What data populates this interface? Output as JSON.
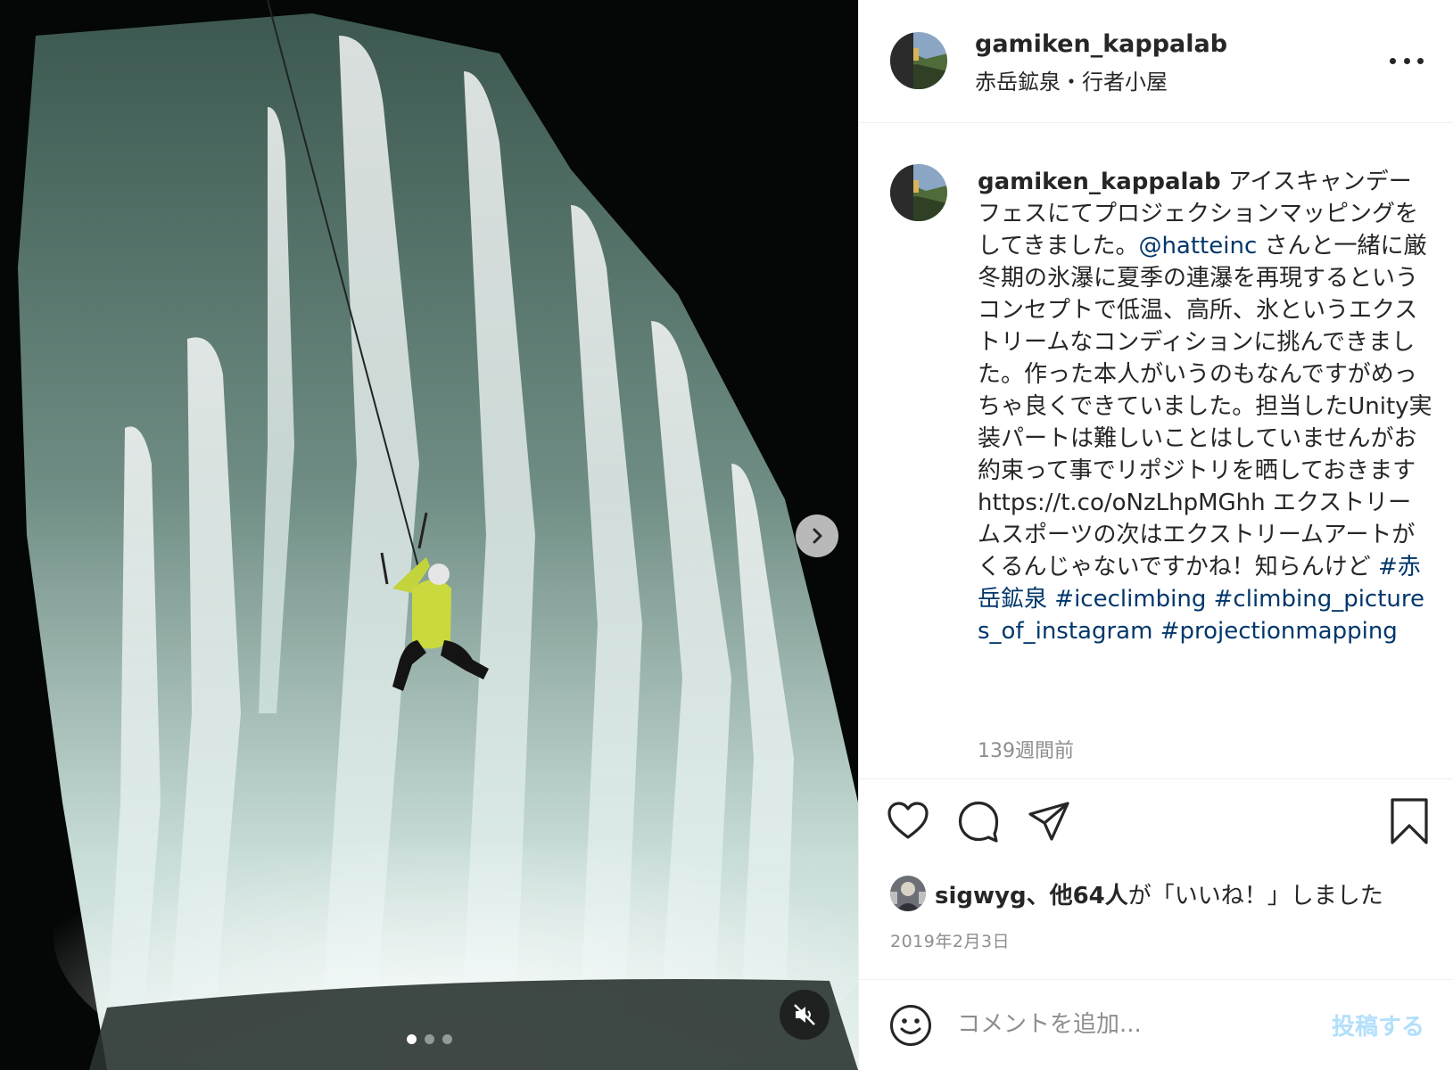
{
  "post": {
    "username": "gamiken_kappalab",
    "location": "赤岳鉱泉・行者小屋",
    "caption": {
      "text_1": "アイスキャンデーフェスにてプロジェクションマッピングをしてきました。",
      "mention": "@hatteinc",
      "text_2": "さんと一緒に厳冬期の氷瀑に夏季の連瀑を再現するというコンセプトで低温、高所、氷というエクストリームなコンディションに挑んできました。作った本人がいうのもなんですがめっちゃ良くできていました。担当したUnity実装パートは難しいことはしていませんがお約束って事でリポジトリを晒しておきます",
      "url": "https://t.co/oNzLhpMGhh",
      "text_3": "エクストリームスポーツの次はエクストリームアートがくるんじゃないですかね！知らんけど",
      "hashtags": [
        "#赤岳鉱泉",
        "#iceclimbing",
        "#climbing_pictures_of_instagram",
        "#projectionmapping"
      ]
    },
    "time_ago": "139週間前",
    "likes": {
      "liker": "sigwyg",
      "connector": "、",
      "others": "他64人",
      "suffix": "が「いいね！」しました"
    },
    "date": "2019年2月3日"
  },
  "comment": {
    "placeholder": "コメントを追加...",
    "post_label": "投稿する"
  },
  "carousel": {
    "slide_count": 3,
    "active_index": 0
  },
  "icons": {
    "more": "more-options-icon",
    "like": "heart-icon",
    "comment": "comment-icon",
    "share": "share-icon",
    "save": "bookmark-icon",
    "emoji": "emoji-icon",
    "next": "chevron-right-icon",
    "mute": "muted-speaker-icon"
  },
  "colors": {
    "link": "#00376b",
    "text": "#262626",
    "muted": "#8e8e8e",
    "post_disabled": "#b2dffc",
    "border": "#efefef"
  }
}
